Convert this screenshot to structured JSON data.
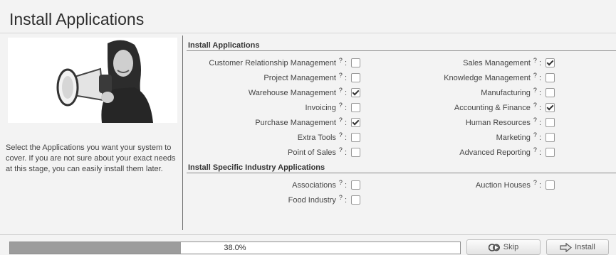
{
  "page": {
    "title": "Install Applications"
  },
  "left": {
    "description": "Select the Applications you want your system to cover. If you are not sure about your exact needs at this stage, you can easily install them later."
  },
  "sections": {
    "apps": {
      "title": "Install Applications"
    },
    "industry": {
      "title": "Install Specific Industry Applications"
    }
  },
  "help": {
    "mark": "?",
    "colon": ":"
  },
  "apps": {
    "left": [
      {
        "label": "Customer Relationship Management",
        "checked": false
      },
      {
        "label": "Project Management",
        "checked": false
      },
      {
        "label": "Warehouse Management",
        "checked": true
      },
      {
        "label": "Invoicing",
        "checked": false
      },
      {
        "label": "Purchase Management",
        "checked": true
      },
      {
        "label": "Extra Tools",
        "checked": false
      },
      {
        "label": "Point of Sales",
        "checked": false
      }
    ],
    "right": [
      {
        "label": "Sales Management",
        "checked": true
      },
      {
        "label": "Knowledge Management",
        "checked": false
      },
      {
        "label": "Manufacturing",
        "checked": false
      },
      {
        "label": "Accounting & Finance",
        "checked": true
      },
      {
        "label": "Human Resources",
        "checked": false
      },
      {
        "label": "Marketing",
        "checked": false
      },
      {
        "label": "Advanced Reporting",
        "checked": false
      }
    ]
  },
  "industry": {
    "left": [
      {
        "label": "Associations",
        "checked": false
      },
      {
        "label": "Food Industry",
        "checked": false
      }
    ],
    "right": [
      {
        "label": "Auction Houses",
        "checked": false
      }
    ]
  },
  "progress": {
    "value": 0.38,
    "text": "38.0%"
  },
  "buttons": {
    "skip": "Skip",
    "install": "Install"
  },
  "colors": {
    "progress_fill": "#9c9c9c",
    "check": "#333333"
  },
  "icons": {
    "skip": "skip-icon",
    "install": "install-arrow-icon",
    "illustration": "woman-megaphone-illustration"
  }
}
